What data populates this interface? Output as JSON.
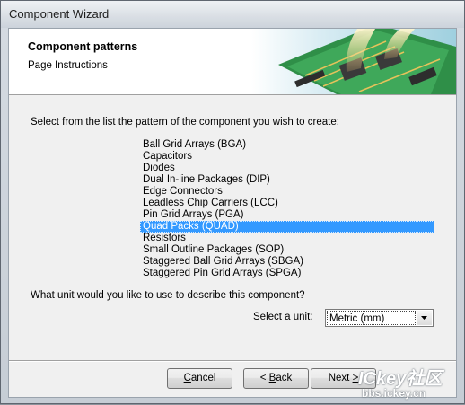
{
  "window": {
    "title": "Component Wizard"
  },
  "header": {
    "title": "Component patterns",
    "subtitle": "Page Instructions"
  },
  "prompt": "Select from the list the pattern of the component you wish to create:",
  "patterns": [
    "Ball Grid Arrays (BGA)",
    "Capacitors",
    "Diodes",
    "Dual In-line Packages (DIP)",
    "Edge Connectors",
    "Leadless Chip Carriers (LCC)",
    "Pin Grid Arrays (PGA)",
    "Quad Packs (QUAD)",
    "Resistors",
    "Small Outline Packages (SOP)",
    "Staggered Ball Grid Arrays (SBGA)",
    "Staggered Pin Grid Arrays (SPGA)"
  ],
  "selected_pattern_index": 7,
  "unit": {
    "question": "What unit would you like to use to describe this component?",
    "label": "Select a unit:",
    "value": "Metric (mm)"
  },
  "buttons": {
    "cancel": {
      "pre": "",
      "accel": "C",
      "post": "ancel"
    },
    "back": {
      "pre": "< ",
      "accel": "B",
      "post": "ack"
    },
    "next": {
      "pre": "Next ",
      "accel": ">",
      "post": ""
    }
  },
  "watermark": {
    "logo": "ICkey社区",
    "url": "bbs.ickey.cn"
  },
  "colors": {
    "selection": "#3399ff",
    "header_bg": "#ffffff",
    "dialog_bg": "#f0f0f0"
  }
}
